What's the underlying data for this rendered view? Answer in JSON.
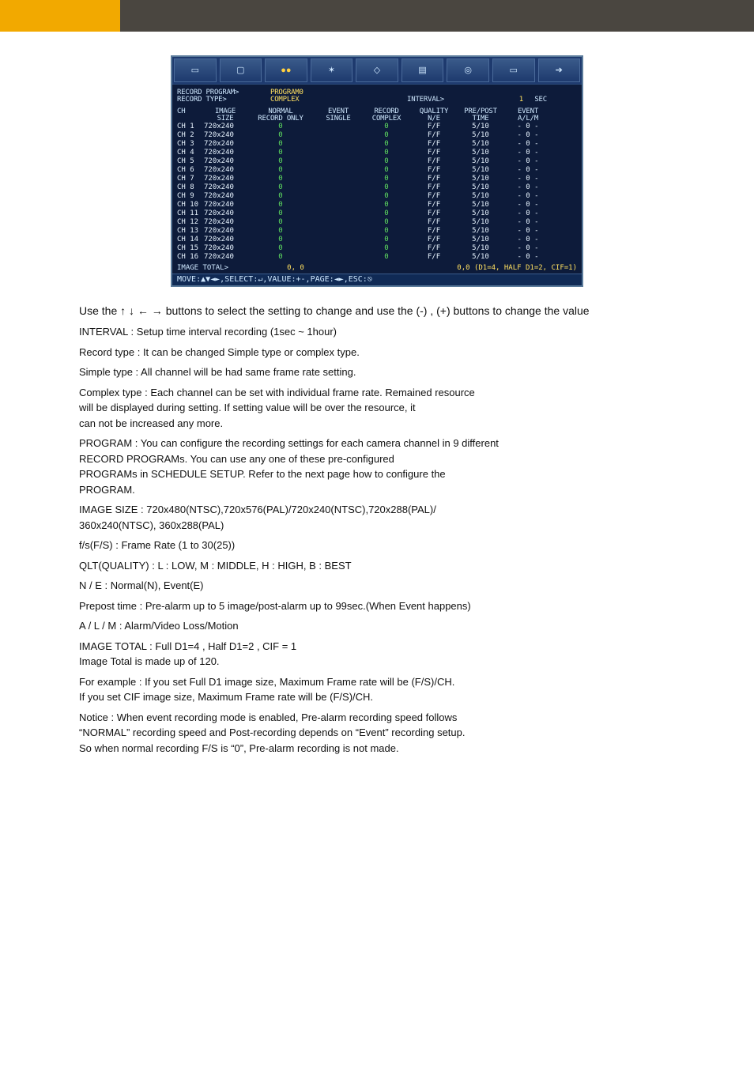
{
  "screenshot": {
    "toolbar_icons": [
      "screen",
      "display",
      "rec-dots",
      "settings",
      "ptz",
      "layout",
      "target",
      "monitor",
      "exit"
    ],
    "line1": {
      "label1": "RECORD PROGRAM>",
      "val1": "PROGRAM0"
    },
    "line2": {
      "label1": "RECORD TYPE>",
      "val1": "COMPLEX",
      "label2": "INTERVAL>",
      "val2": "1",
      "unit": "SEC"
    },
    "headers1": {
      "ch": "CH",
      "size": "IMAGE",
      "nrm": "NORMAL",
      "evt": "EVENT",
      "rec": "RECORD",
      "qual": "QUALITY",
      "pp": "PRE/POST",
      "alm": "EVENT"
    },
    "headers2": {
      "ch": "",
      "size": "SIZE",
      "nrm": "RECORD ONLY",
      "evt": "SINGLE",
      "rec": "COMPLEX",
      "qual": "N/E",
      "pp": "TIME",
      "alm": "A/L/M"
    },
    "rows": [
      {
        "ch": "CH",
        "n": "1",
        "size": "720x240",
        "nrm": "0",
        "rec": "0",
        "qual": "F/F",
        "pp": "5/10",
        "alm": "- 0 -"
      },
      {
        "ch": "CH",
        "n": "2",
        "size": "720x240",
        "nrm": "0",
        "rec": "0",
        "qual": "F/F",
        "pp": "5/10",
        "alm": "- 0 -"
      },
      {
        "ch": "CH",
        "n": "3",
        "size": "720x240",
        "nrm": "0",
        "rec": "0",
        "qual": "F/F",
        "pp": "5/10",
        "alm": "- 0 -"
      },
      {
        "ch": "CH",
        "n": "4",
        "size": "720x240",
        "nrm": "0",
        "rec": "0",
        "qual": "F/F",
        "pp": "5/10",
        "alm": "- 0 -"
      },
      {
        "ch": "CH",
        "n": "5",
        "size": "720x240",
        "nrm": "0",
        "rec": "0",
        "qual": "F/F",
        "pp": "5/10",
        "alm": "- 0 -"
      },
      {
        "ch": "CH",
        "n": "6",
        "size": "720x240",
        "nrm": "0",
        "rec": "0",
        "qual": "F/F",
        "pp": "5/10",
        "alm": "- 0 -"
      },
      {
        "ch": "CH",
        "n": "7",
        "size": "720x240",
        "nrm": "0",
        "rec": "0",
        "qual": "F/F",
        "pp": "5/10",
        "alm": "- 0 -"
      },
      {
        "ch": "CH",
        "n": "8",
        "size": "720x240",
        "nrm": "0",
        "rec": "0",
        "qual": "F/F",
        "pp": "5/10",
        "alm": "- 0 -"
      },
      {
        "ch": "CH",
        "n": "9",
        "size": "720x240",
        "nrm": "0",
        "rec": "0",
        "qual": "F/F",
        "pp": "5/10",
        "alm": "- 0 -"
      },
      {
        "ch": "CH",
        "n": "10",
        "size": "720x240",
        "nrm": "0",
        "rec": "0",
        "qual": "F/F",
        "pp": "5/10",
        "alm": "- 0 -"
      },
      {
        "ch": "CH",
        "n": "11",
        "size": "720x240",
        "nrm": "0",
        "rec": "0",
        "qual": "F/F",
        "pp": "5/10",
        "alm": "- 0 -"
      },
      {
        "ch": "CH",
        "n": "12",
        "size": "720x240",
        "nrm": "0",
        "rec": "0",
        "qual": "F/F",
        "pp": "5/10",
        "alm": "- 0 -"
      },
      {
        "ch": "CH",
        "n": "13",
        "size": "720x240",
        "nrm": "0",
        "rec": "0",
        "qual": "F/F",
        "pp": "5/10",
        "alm": "- 0 -"
      },
      {
        "ch": "CH",
        "n": "14",
        "size": "720x240",
        "nrm": "0",
        "rec": "0",
        "qual": "F/F",
        "pp": "5/10",
        "alm": "- 0 -"
      },
      {
        "ch": "CH",
        "n": "15",
        "size": "720x240",
        "nrm": "0",
        "rec": "0",
        "qual": "F/F",
        "pp": "5/10",
        "alm": "- 0 -"
      },
      {
        "ch": "CH",
        "n": "16",
        "size": "720x240",
        "nrm": "0",
        "rec": "0",
        "qual": "F/F",
        "pp": "5/10",
        "alm": "- 0 -"
      }
    ],
    "footer": {
      "label": "IMAGE TOTAL>",
      "left": "0, 0",
      "right": "0,0 (D1=4, HALF D1=2, CIF=1)"
    },
    "helpbar": "MOVE:▲▼◄►,SELECT:↵,VALUE:+-,PAGE:◄►,ESC:⎋"
  },
  "body": {
    "p1_pre": "Use the ",
    "p1_arrows": "↑ ↓ ← →",
    "p1_post": " buttons to select the setting to change and use the (-) , (+) buttons to change the value",
    "p2_label": "INTERVAL ",
    "p2_text": ": Setup time interval recording (1sec ~ 1hour)",
    "p3_label": "               Record type",
    "p3_text": " : It can be changed Simple type or complex type.",
    "p4_label": "               Simple type",
    "p4_text": " : All channel will be had same frame rate setting.",
    "p5_label": "               Complex type",
    "p5_text": " : Each channel can be set with individual frame rate. Remained resource",
    "p5_text2": "                              will be displayed during setting. If setting value will be over the resource, it",
    "p5_text3": "                              can not be increased any more.",
    "p6_label": "PROGRAM ",
    "p6_text": ": You can configure the recording settings for each camera channel in 9 different",
    "p6_text2": "                  RECORD PROGRAMs. You can use any one of these pre-configured",
    "p6_text3": "                  PROGRAMs in SCHEDULE SETUP. Refer to the next page how to configure the",
    "p6_text4": "                  PROGRAM.",
    "p7_label": "IMAGE SIZE ",
    "p7_text": ": 720x480(NTSC),720x576(PAL)/720x240(NTSC),720x288(PAL)/",
    "p7_text2": "                     360x240(NTSC), 360x288(PAL)",
    "p8_label": "f/s(F/S) ",
    "p8_text": " : Frame Rate (1 to 30(25))",
    "p9_label": "QLT(QUALITY) ",
    "p9_text": ": L : LOW, M : MIDDLE, H : HIGH, B : BEST",
    "p10_label": "N / E",
    "p10_text": " : Normal(N), Event(E)",
    "p11_label": "Prepost time",
    "p11_text": " : Pre-alarm up to 5 image/post-alarm up to 99sec.(When Event happens)",
    "p12_label": "A / L / M",
    "p12_text": " : Alarm/Video Loss/Motion",
    "p13_label": "IMAGE TOTAL",
    "p13_text": " :  Full D1=4 , Half D1=2 , CIF = 1",
    "p13_text2": "      Image Total is made up of 120.",
    "p14_label": "For example",
    "p14_text": " : If you set Full D1  image size, Maximum Frame rate will be         (F/S)/CH.",
    "p14_text2": "                       If you set CIF image size, Maximum Frame rate will be         (F/S)/CH.",
    "note_label": "Notice",
    "note_text": ": When event recording mode is enabled, Pre-alarm recording speed follows",
    "note_text2": "           “NORMAL” recording speed and Post-recording depends on “Event” recording setup.",
    "note_text3": "            So when normal recording F/S is “0”, Pre-alarm recording is not made."
  }
}
